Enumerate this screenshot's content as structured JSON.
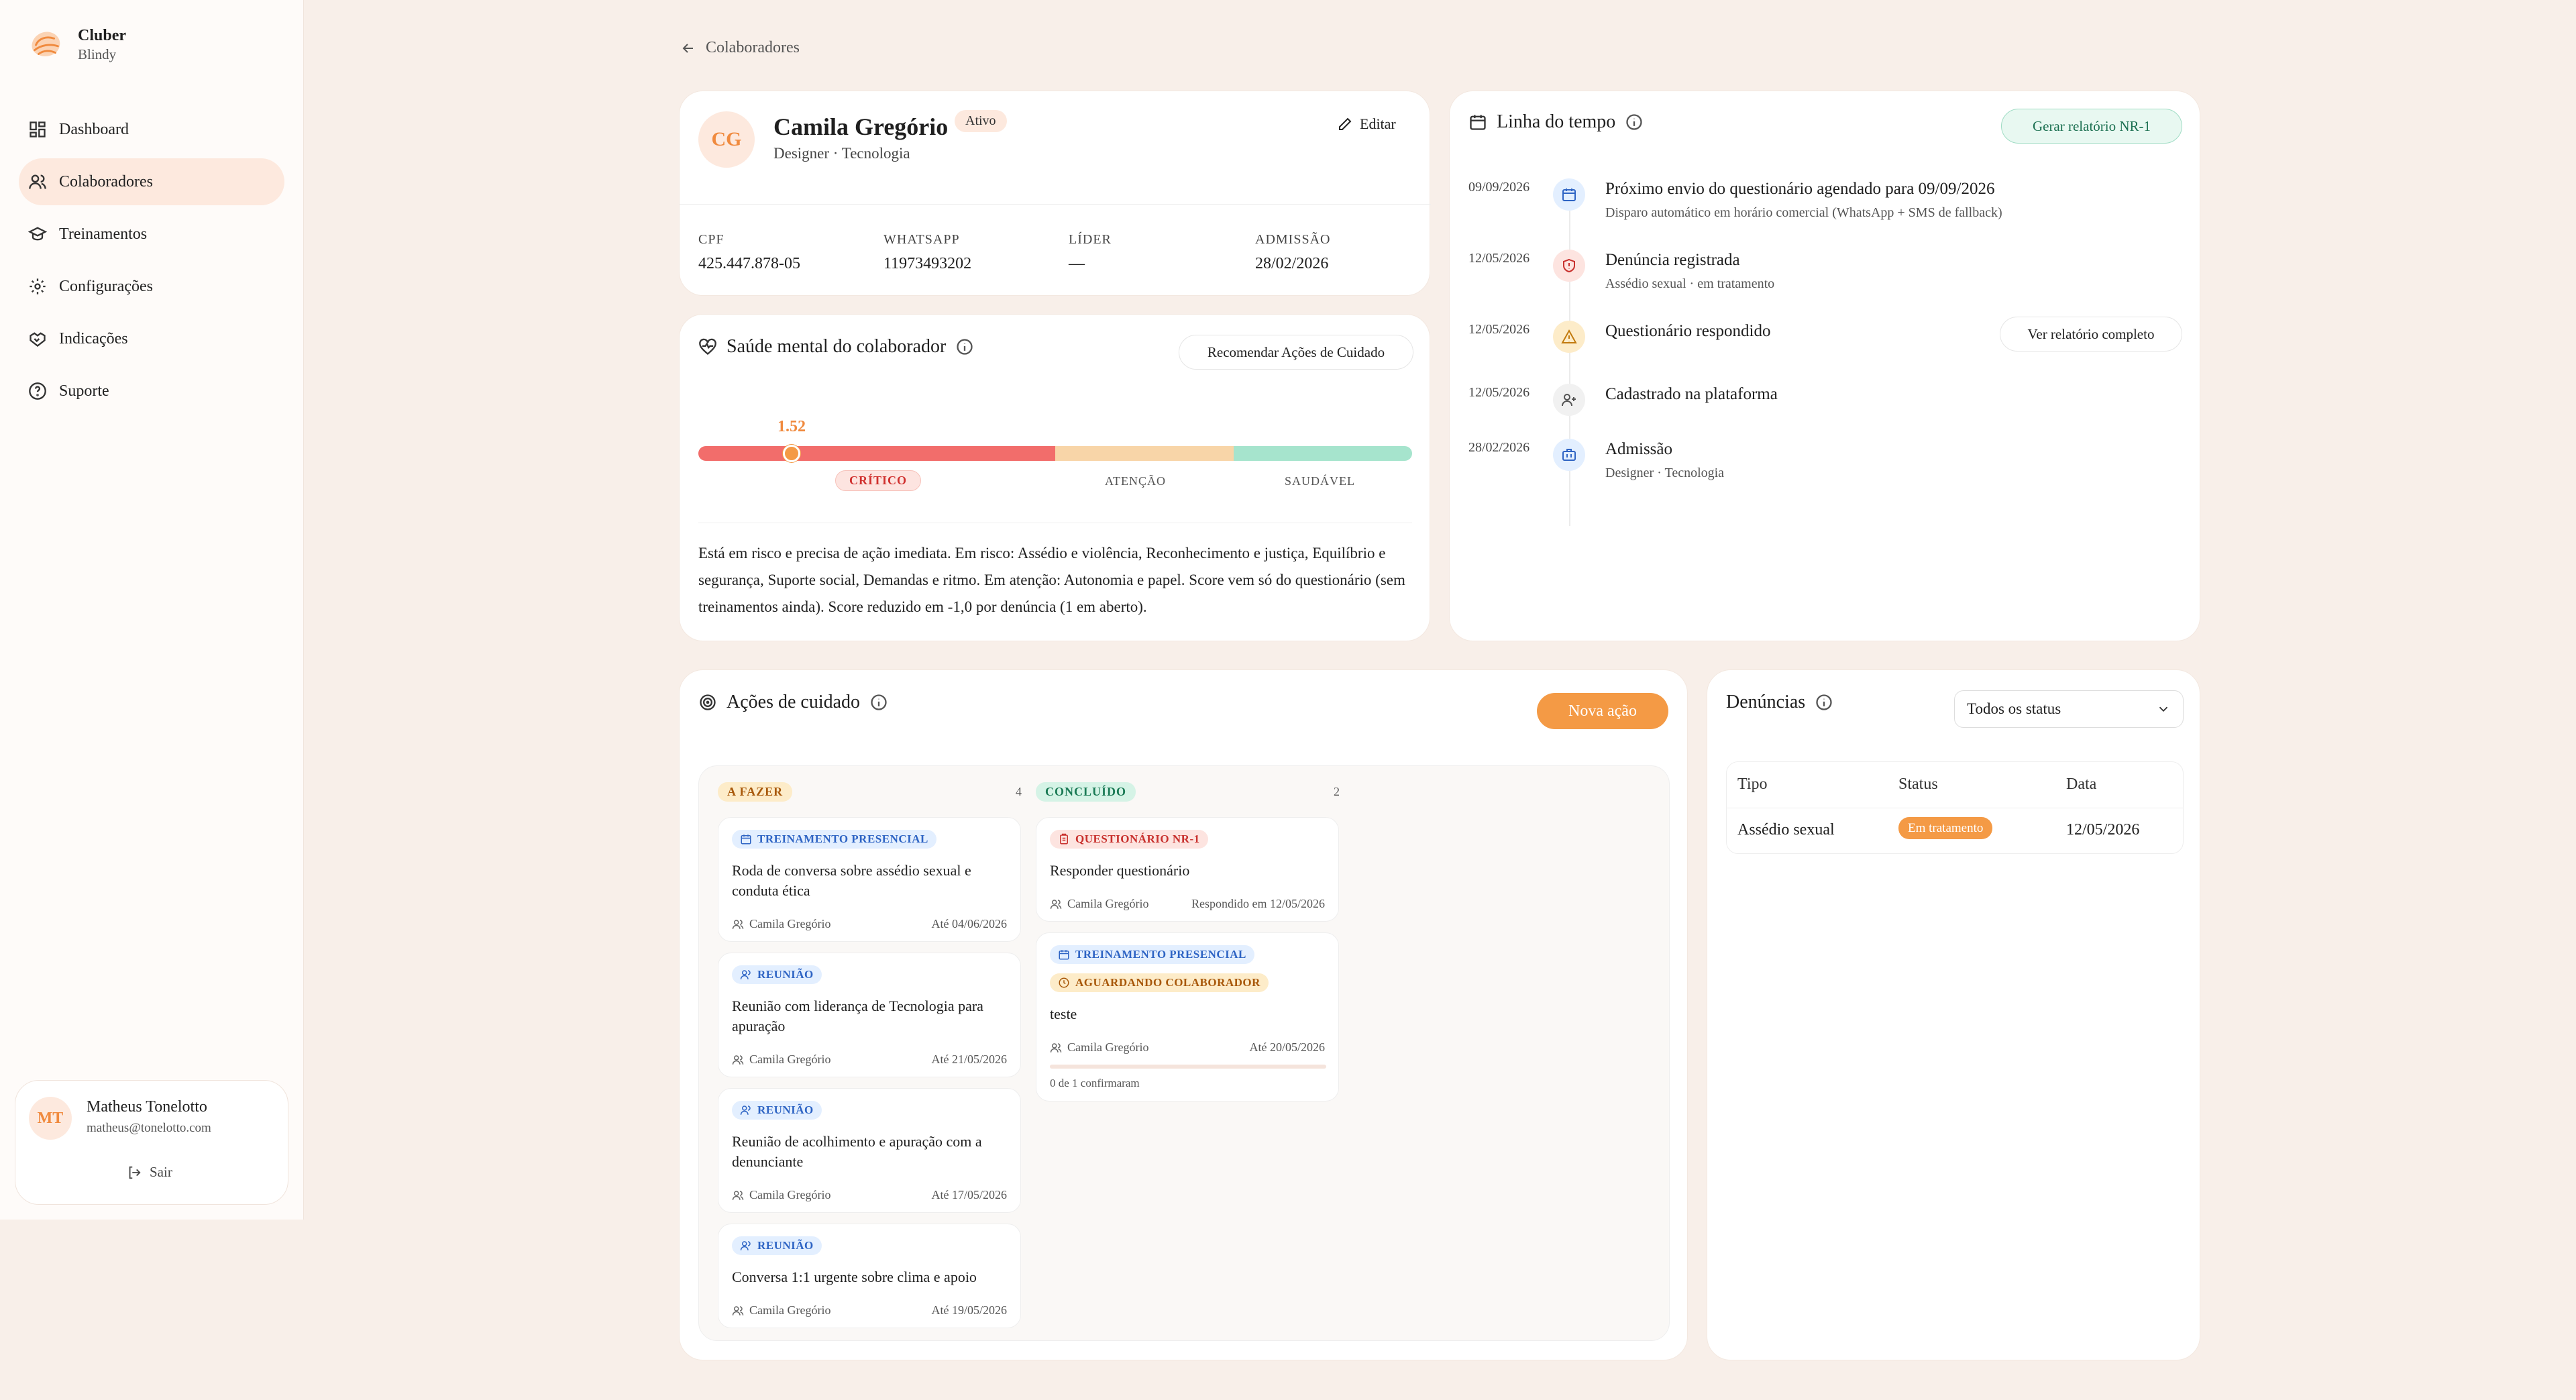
{
  "sidebar": {
    "brand_name": "Cluber",
    "brand_sub": "Blindy",
    "items": [
      {
        "label": "Dashboard",
        "icon": "grid-icon"
      },
      {
        "label": "Colaboradores",
        "icon": "users-icon"
      },
      {
        "label": "Treinamentos",
        "icon": "graduation-cap-icon"
      },
      {
        "label": "Configurações",
        "icon": "gear-icon"
      },
      {
        "label": "Indicações",
        "icon": "handshake-icon"
      },
      {
        "label": "Suporte",
        "icon": "help-circle-icon"
      }
    ],
    "active_index": 1,
    "user": {
      "initials": "MT",
      "name": "Matheus Tonelotto",
      "email": "matheus@tonelotto.com",
      "logout_label": "Sair"
    }
  },
  "breadcrumb": {
    "back_label": "Colaboradores"
  },
  "profile": {
    "initials": "CG",
    "name": "Camila Gregório",
    "role": "Designer · Tecnologia",
    "status": "Ativo",
    "edit_label": "Editar",
    "fields": [
      {
        "label": "CPF",
        "value": "425.447.878-05"
      },
      {
        "label": "WHATSAPP",
        "value": "11973493202"
      },
      {
        "label": "LÍDER",
        "value": "—"
      },
      {
        "label": "ADMISSÃO",
        "value": "28/02/2026"
      }
    ]
  },
  "mental_health": {
    "title": "Saúde mental do colaborador",
    "recommend_label": "Recomendar Ações de Cuidado",
    "score": "1.52",
    "score_value": 1.52,
    "zones": [
      "CRÍTICO",
      "ATENÇÃO",
      "SAUDÁVEL"
    ],
    "description": "Está em risco e precisa de ação imediata. Em risco: Assédio e violência, Reconhecimento e justiça, Equilíbrio e segurança, Suporte social, Demandas e ritmo. Em atenção: Autonomia e papel. Score vem só do questionário (sem treinamentos ainda). Score reduzido em -1,0 por denúncia (1 em aberto)."
  },
  "timeline": {
    "title": "Linha do tempo",
    "report_label": "Gerar relatório NR-1",
    "events": [
      {
        "date": "09/09/2026",
        "title": "Próximo envio do questionário agendado para 09/09/2026",
        "sub": "Disparo automático em horário comercial (WhatsApp + SMS de fallback)",
        "icon": "calendar-icon",
        "color": "#2e64c4",
        "bg": "#e3efff"
      },
      {
        "date": "12/05/2026",
        "title": "Denúncia registrada",
        "sub": "Assédio sexual · em tratamento",
        "icon": "shield-icon",
        "color": "#c8302d",
        "bg": "#fde4e0"
      },
      {
        "date": "12/05/2026",
        "title": "Questionário respondido",
        "sub": "",
        "icon": "warning-icon",
        "color": "#c27a0e",
        "bg": "#fdecc9",
        "action_label": "Ver relatório completo"
      },
      {
        "date": "12/05/2026",
        "title": "Cadastrado na plataforma",
        "sub": "",
        "icon": "user-plus-icon",
        "color": "#555555",
        "bg": "#f1f1f1"
      },
      {
        "date": "28/02/2026",
        "title": "Admissão",
        "sub": "Designer · Tecnologia",
        "icon": "briefcase-icon",
        "color": "#2e64c4",
        "bg": "#e3efff"
      }
    ]
  },
  "care_actions": {
    "title": "Ações de cuidado",
    "new_label": "Nova ação",
    "columns": [
      {
        "label": "A FAZER",
        "count": "4"
      },
      {
        "label": "CONCLUÍDO",
        "count": "2"
      }
    ],
    "todo": [
      {
        "tag": "TREINAMENTO PRESENCIAL",
        "title": "Roda de conversa sobre assédio sexual e conduta ética",
        "who": "Camila Gregório",
        "due": "Até 04/06/2026"
      },
      {
        "tag": "REUNIÃO",
        "title": "Reunião com liderança de Tecnologia para apuração",
        "who": "Camila Gregório",
        "due": "Até 21/05/2026"
      },
      {
        "tag": "REUNIÃO",
        "title": "Reunião de acolhimento e apuração com a denunciante",
        "who": "Camila Gregório",
        "due": "Até 17/05/2026"
      },
      {
        "tag": "REUNIÃO",
        "title": "Conversa 1:1 urgente sobre clima e apoio",
        "who": "Camila Gregório",
        "due": "Até 19/05/2026"
      }
    ],
    "done": [
      {
        "tag": "QUESTIONÁRIO NR-1",
        "title": "Responder questionário",
        "who": "Camila Gregório",
        "due": "Respondido em 12/05/2026"
      },
      {
        "tag": "TREINAMENTO PRESENCIAL",
        "tag2": "AGUARDANDO COLABORADOR",
        "title": "teste",
        "who": "Camila Gregório",
        "due": "Até 20/05/2026",
        "progress_text": "0 de 1 confirmaram",
        "progress": 0
      }
    ]
  },
  "complaints": {
    "title": "Denúncias",
    "filter_value": "Todos os status",
    "headers": [
      "Tipo",
      "Status",
      "Data"
    ],
    "rows": [
      {
        "tipo": "Assédio sexual",
        "status": "Em tratamento",
        "data": "12/05/2026"
      }
    ]
  },
  "colors": {
    "accent": "#f49a45",
    "critical": "#f26d6b",
    "attention": "#f8d5a8",
    "healthy": "#a6e4cd"
  }
}
